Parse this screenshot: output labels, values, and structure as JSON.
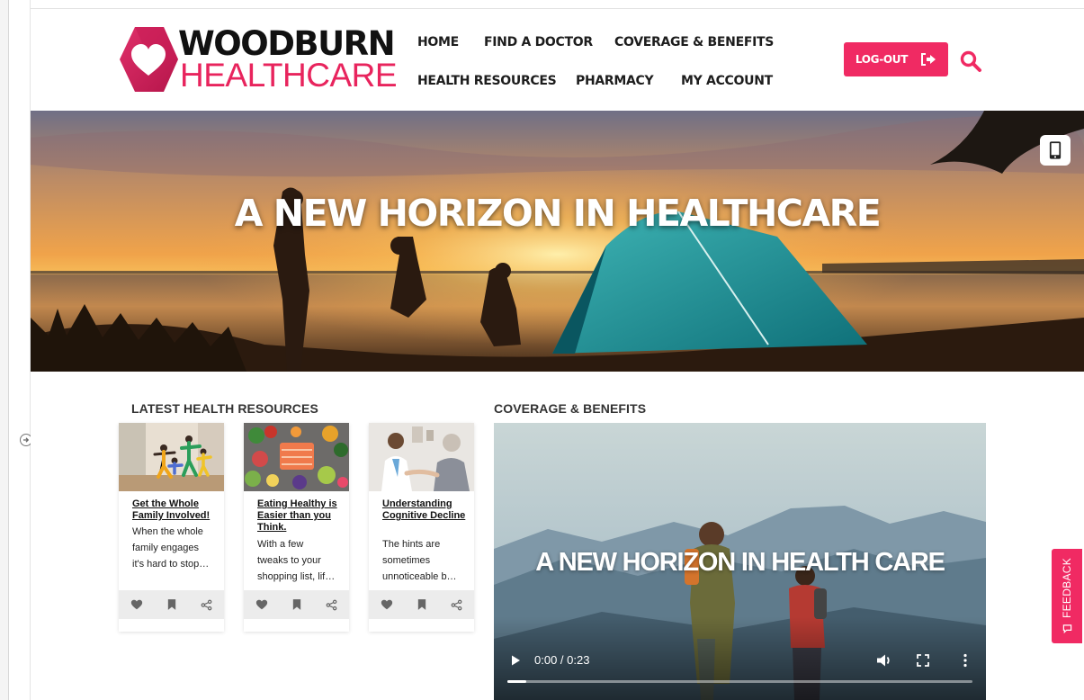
{
  "brand": {
    "name_line1": "WOODBURN",
    "name_line2": "HEALTHCARE",
    "accent_color": "#f02a63",
    "text_color": "#111111"
  },
  "nav": {
    "items": [
      "HOME",
      "FIND A DOCTOR",
      "COVERAGE & BENEFITS",
      "HEALTH RESOURCES",
      "PHARMACY",
      "MY ACCOUNT"
    ]
  },
  "header": {
    "logout_label": "LOG-OUT",
    "logout_icon": "logout-icon",
    "search_icon": "search-icon"
  },
  "hero": {
    "title": "A NEW HORIZON IN HEALTHCARE",
    "device_icon": "mobile-device-icon"
  },
  "resources": {
    "section_title": "LATEST HEALTH RESOURCES",
    "cards": [
      {
        "title": "Get the Whole Family Involved!",
        "excerpt_lines": [
          "When the whole",
          "family engages",
          "it's hard to stop…"
        ],
        "image": "family-yoga"
      },
      {
        "title": "Eating Healthy is Easier than you Think.",
        "excerpt_lines": [
          "With a few",
          "tweaks to your",
          "shopping list, lif…"
        ],
        "image": "healthy-food"
      },
      {
        "title": "Understanding Cognitive Decline",
        "excerpt_lines": [
          "The hints are",
          "sometimes",
          "unnoticeable b…"
        ],
        "image": "doctor-visit"
      }
    ],
    "action_icons": [
      "heart-icon",
      "bookmark-icon",
      "share-icon"
    ]
  },
  "coverage": {
    "section_title": "COVERAGE & BENEFITS",
    "video": {
      "overlay_title": "A NEW HORIZON IN HEALTH CARE",
      "time": "0:00 / 0:23",
      "progress": 0.04,
      "controls": [
        "play-icon",
        "volume-icon",
        "fullscreen-icon",
        "more-options-icon"
      ]
    }
  },
  "feedback": {
    "label": "FEEDBACK"
  }
}
